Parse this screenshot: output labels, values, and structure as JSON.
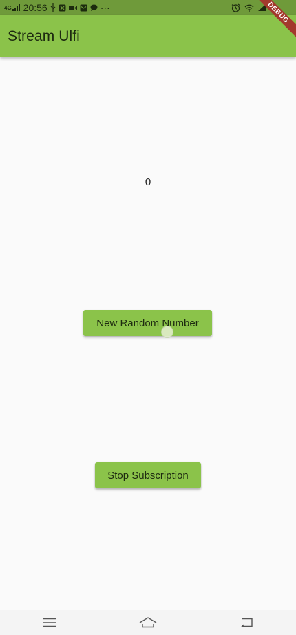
{
  "status_bar": {
    "network": "4G",
    "time": "20:56",
    "more": "···"
  },
  "app_bar": {
    "title": "Stream Ulfi"
  },
  "debug_banner": {
    "label": "DEBUG"
  },
  "main": {
    "counter": "0",
    "new_random_number_label": "New Random Number",
    "stop_subscription_label": "Stop Subscription"
  },
  "colors": {
    "primary": "#8bc34a",
    "status_bar": "#6f9a3a",
    "background": "#fafafa",
    "debug_banner": "#a3392d"
  }
}
